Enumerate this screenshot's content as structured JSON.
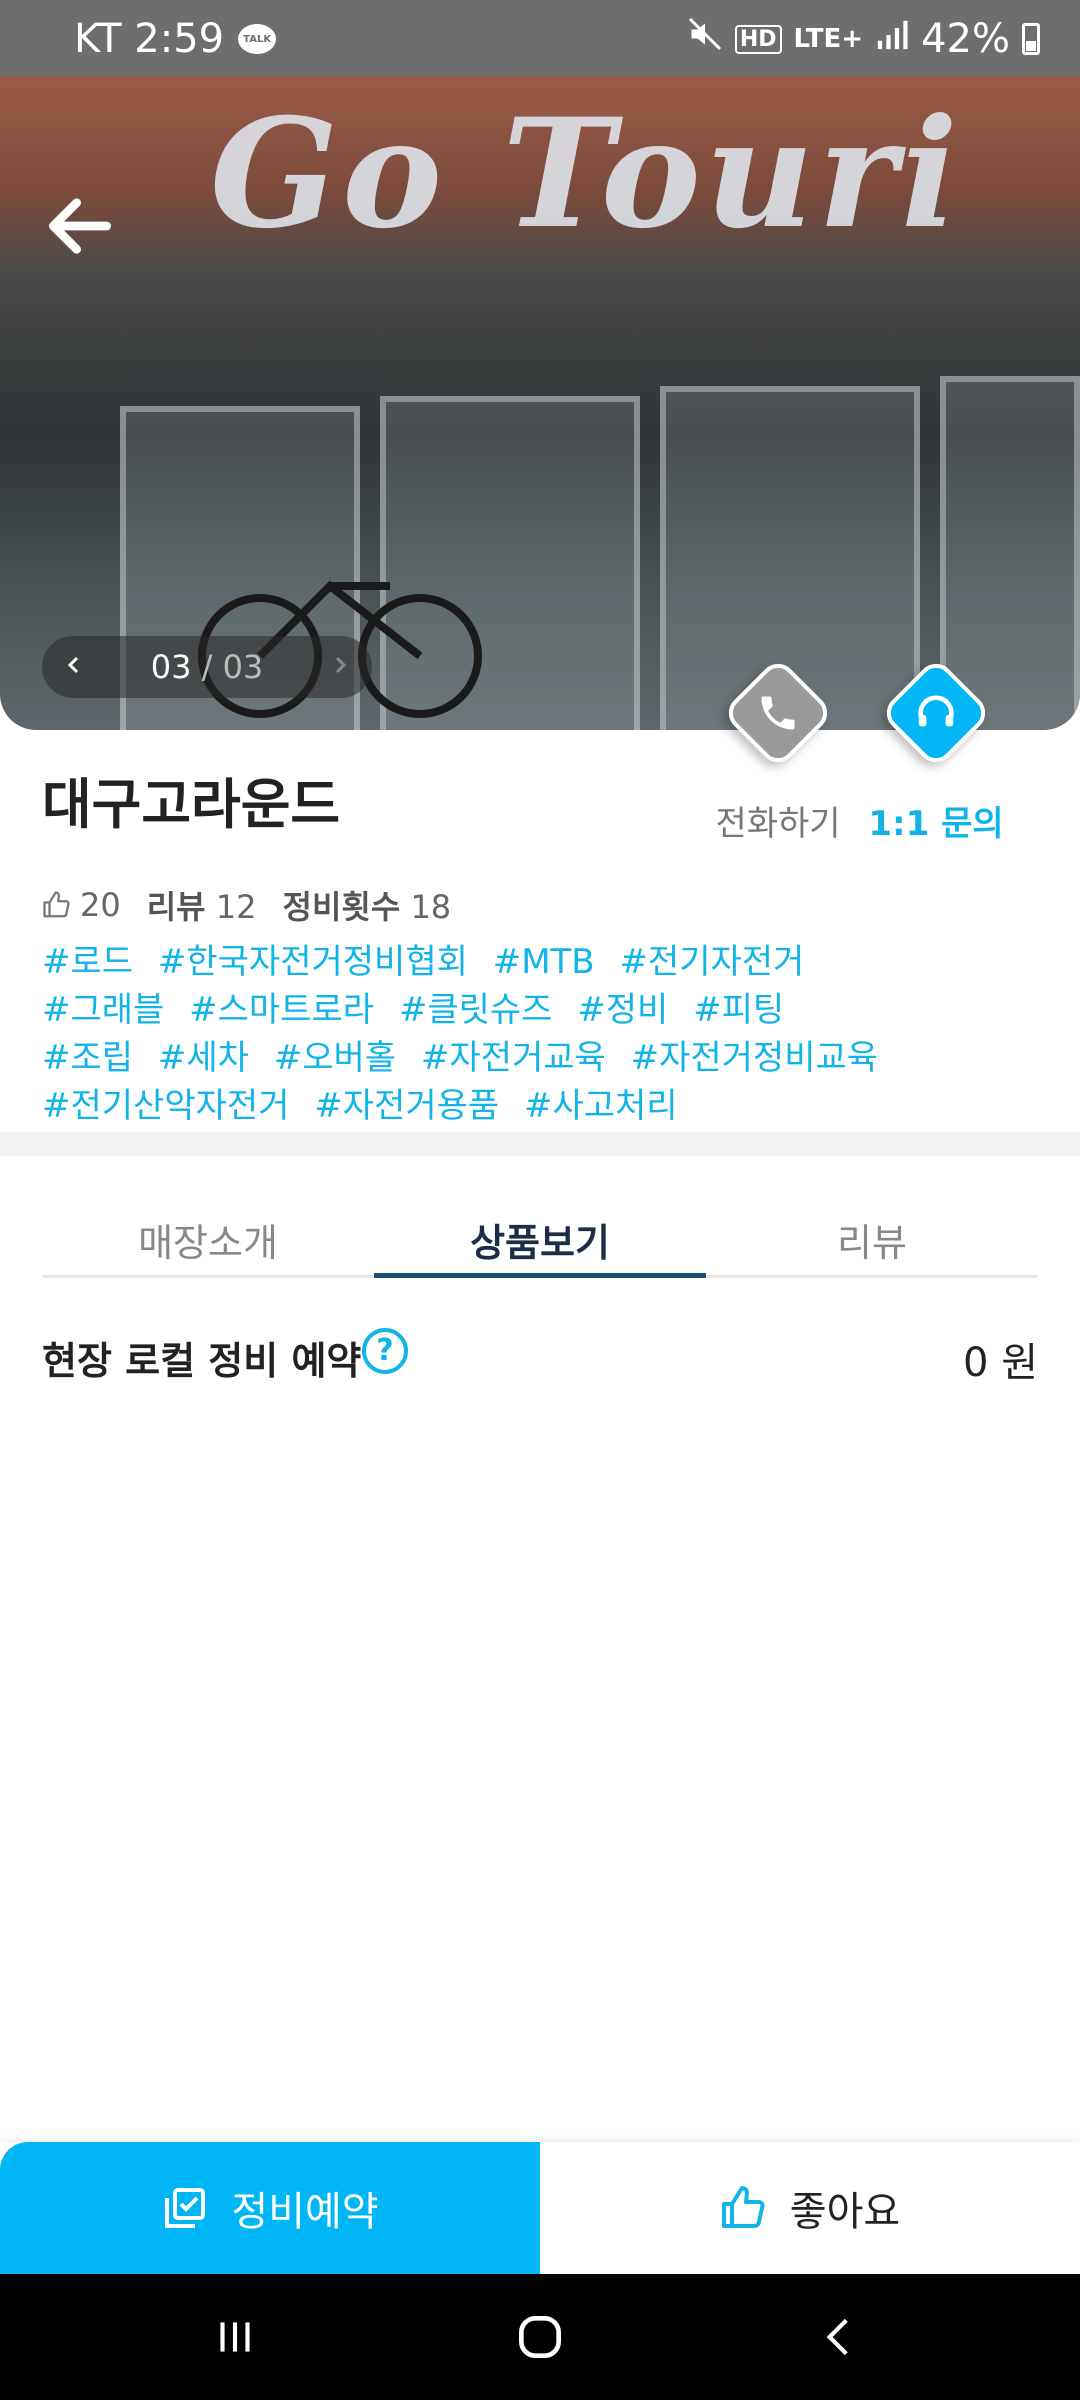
{
  "status_bar": {
    "carrier_time": "KT 2:59",
    "talk_badge": "TALK",
    "hd": "HD",
    "network": "LTE+",
    "battery": "42%"
  },
  "hero": {
    "sign_text": "Go Touri",
    "pager": {
      "current": "03",
      "total": "/ 03"
    }
  },
  "actions": {
    "call_label": "전화하기",
    "inquiry_label": "1:1 문의"
  },
  "store": {
    "name": "대구고라운드",
    "likes": "20",
    "review_label": "리뷰",
    "review_count": "12",
    "service_label": "정비횟수",
    "service_count": "18",
    "tags": [
      "#로드",
      "#한국자전거정비협회",
      "#MTB",
      "#전기자전거",
      "#그래블",
      "#스마트로라",
      "#클릿슈즈",
      "#정비",
      "#피팅",
      "#조립",
      "#세차",
      "#오버홀",
      "#자전거교육",
      "#자전거정비교육",
      "#전기산악자전거",
      "#자전거용품",
      "#사고처리"
    ]
  },
  "tabs": [
    {
      "label": "매장소개",
      "active": false
    },
    {
      "label": "상품보기",
      "active": true
    },
    {
      "label": "리뷰",
      "active": false
    }
  ],
  "service": {
    "title": "현장 로컬 정비 예약",
    "help": "?",
    "price": "0 원"
  },
  "bottom": {
    "reserve_label": "정비예약",
    "like_label": "좋아요"
  },
  "colors": {
    "accent": "#00b6f5",
    "tag": "#12b4e8",
    "tab_active": "#1a4f73",
    "call_diamond": "#9a9a9a"
  }
}
